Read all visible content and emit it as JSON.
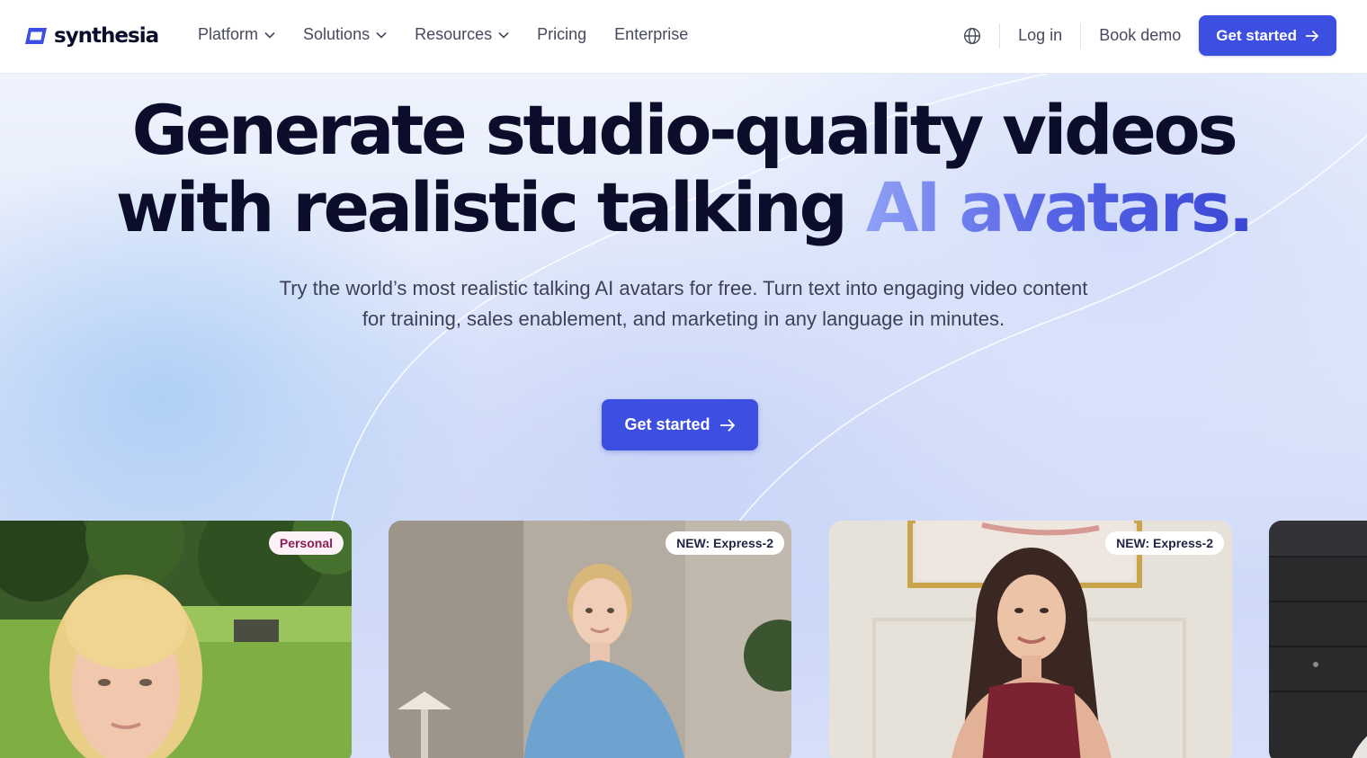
{
  "brand": {
    "name": "synthesia",
    "accent": "#3d4fe0"
  },
  "nav": {
    "menu": [
      {
        "label": "Platform",
        "has_dropdown": true
      },
      {
        "label": "Solutions",
        "has_dropdown": true
      },
      {
        "label": "Resources",
        "has_dropdown": true
      },
      {
        "label": "Pricing",
        "has_dropdown": false
      },
      {
        "label": "Enterprise",
        "has_dropdown": false
      }
    ],
    "language_icon": "globe-icon",
    "login": "Log in",
    "book_demo": "Book demo",
    "cta": "Get started"
  },
  "hero": {
    "headline_line1": "Generate studio-quality videos",
    "headline_line2_plain": "with realistic talking ",
    "headline_line2_accent": "AI avatars.",
    "subtitle": "Try the world’s most realistic talking AI avatars for free. Turn text into engaging video content for training, sales enablement, and marketing in any language in minutes.",
    "cta": "Get started"
  },
  "cards": [
    {
      "badge": "Personal",
      "scene": "outdoor park, blonde woman"
    },
    {
      "badge": "NEW: Express-2",
      "scene": "studio, woman in blue sweater"
    },
    {
      "badge": "NEW: Express-2",
      "scene": "living room, woman in burgundy top"
    },
    {
      "badge": "",
      "scene": "dark wall"
    }
  ]
}
